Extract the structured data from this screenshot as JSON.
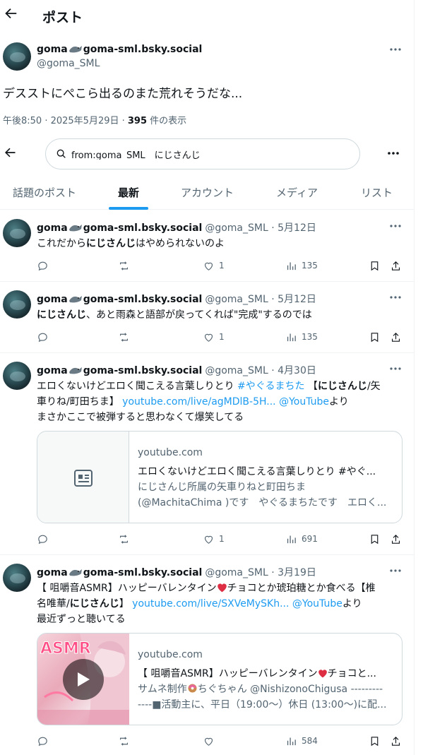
{
  "header": {
    "title": "ポスト"
  },
  "main_post": {
    "display_name": "goma",
    "display_name_suffix": "goma-sml.bsky.social",
    "handle": "@goma_SML",
    "text": "デスストにぺこら出るのまた荒れそうだな...",
    "time": "午後8:50 · 2025年5月29日 · ",
    "views": "395",
    "views_suffix": " 件の表示"
  },
  "search": {
    "query": "from:goma_SML　にじさんじ"
  },
  "tabs": [
    "話題のポスト",
    "最新",
    "アカウント",
    "メディア",
    "リスト"
  ],
  "active_tab": "最新",
  "tweets": [
    {
      "name": "goma",
      "name_suffix": "goma-sml.bsky.social",
      "handle": "@goma_SML · 5月12日",
      "line1_a": "これだから",
      "line1_b": "にじさんじ",
      "line1_c": "はやめられないのよ",
      "likes": "1",
      "views": "135"
    },
    {
      "name": "goma",
      "name_suffix": "goma-sml.bsky.social",
      "handle": "@goma_SML · 5月12日",
      "line1_b": "にじさんじ",
      "line1_c": "、あと雨森と語部が戻ってくれば\"完成\"するのでは",
      "likes": "1",
      "views": "135"
    },
    {
      "name": "goma",
      "name_suffix": "goma-sml.bsky.social",
      "handle": "@goma_SML · 4月30日",
      "l1a": "エロくないけどエロく聞こえる言葉しりとり ",
      "l1tag": "#やぐるまちた",
      "l1b": " 【",
      "l1bold": "にじさんじ",
      "l1c": "/矢",
      "l2a": "車りね/町田ちま】 ",
      "l2link": "youtube.com/live/agMDlB-5H...",
      "l2yt": " @YouTube",
      "l2c": "より",
      "l3": "まさかここで被弾すると思わなくて爆笑してる",
      "card_domain": "youtube.com",
      "card_title": "エロくないけどエロく聞こえる言葉しりとり #やぐ...",
      "card_desc1": "にじさんじ所属の矢車りねと町田ちま",
      "card_desc2": "(@MachitaChima )です　やぐるまちたです　エロく...",
      "likes": "1",
      "views": "691"
    },
    {
      "name": "goma",
      "name_suffix": "goma-sml.bsky.social",
      "handle": "@goma_SML · 3月19日",
      "l1a": "【 咀嚼音ASMR】ハッピーバレンタイン",
      "l1b": "チョコとか琥珀糖とか食べる【椎",
      "l2a": "名唯華/",
      "l2bold": "にじさんじ",
      "l2b": "】 ",
      "l2link": "youtube.com/live/SXVeMySKh...",
      "l2yt": " @YouTube",
      "l2c": "より",
      "l3": "最近ずっと聴いてる",
      "card_domain": "youtube.com",
      "card_title_a": "【 咀嚼音ASMR】ハッピーバレンタイン",
      "card_title_b": "チョコと...",
      "card_desc1a": "サムネ制作",
      "card_desc1b": "ちぐちゃん @NishizonoChigusa ---------",
      "card_desc2": "----■活動主に、平日（19:00～）休日 (13:00～)に配...",
      "views": "584"
    }
  ],
  "colors": {
    "accent": "#1d9bf0",
    "text": "#0f1419",
    "secondary": "#536471",
    "border": "#eff3f4"
  }
}
